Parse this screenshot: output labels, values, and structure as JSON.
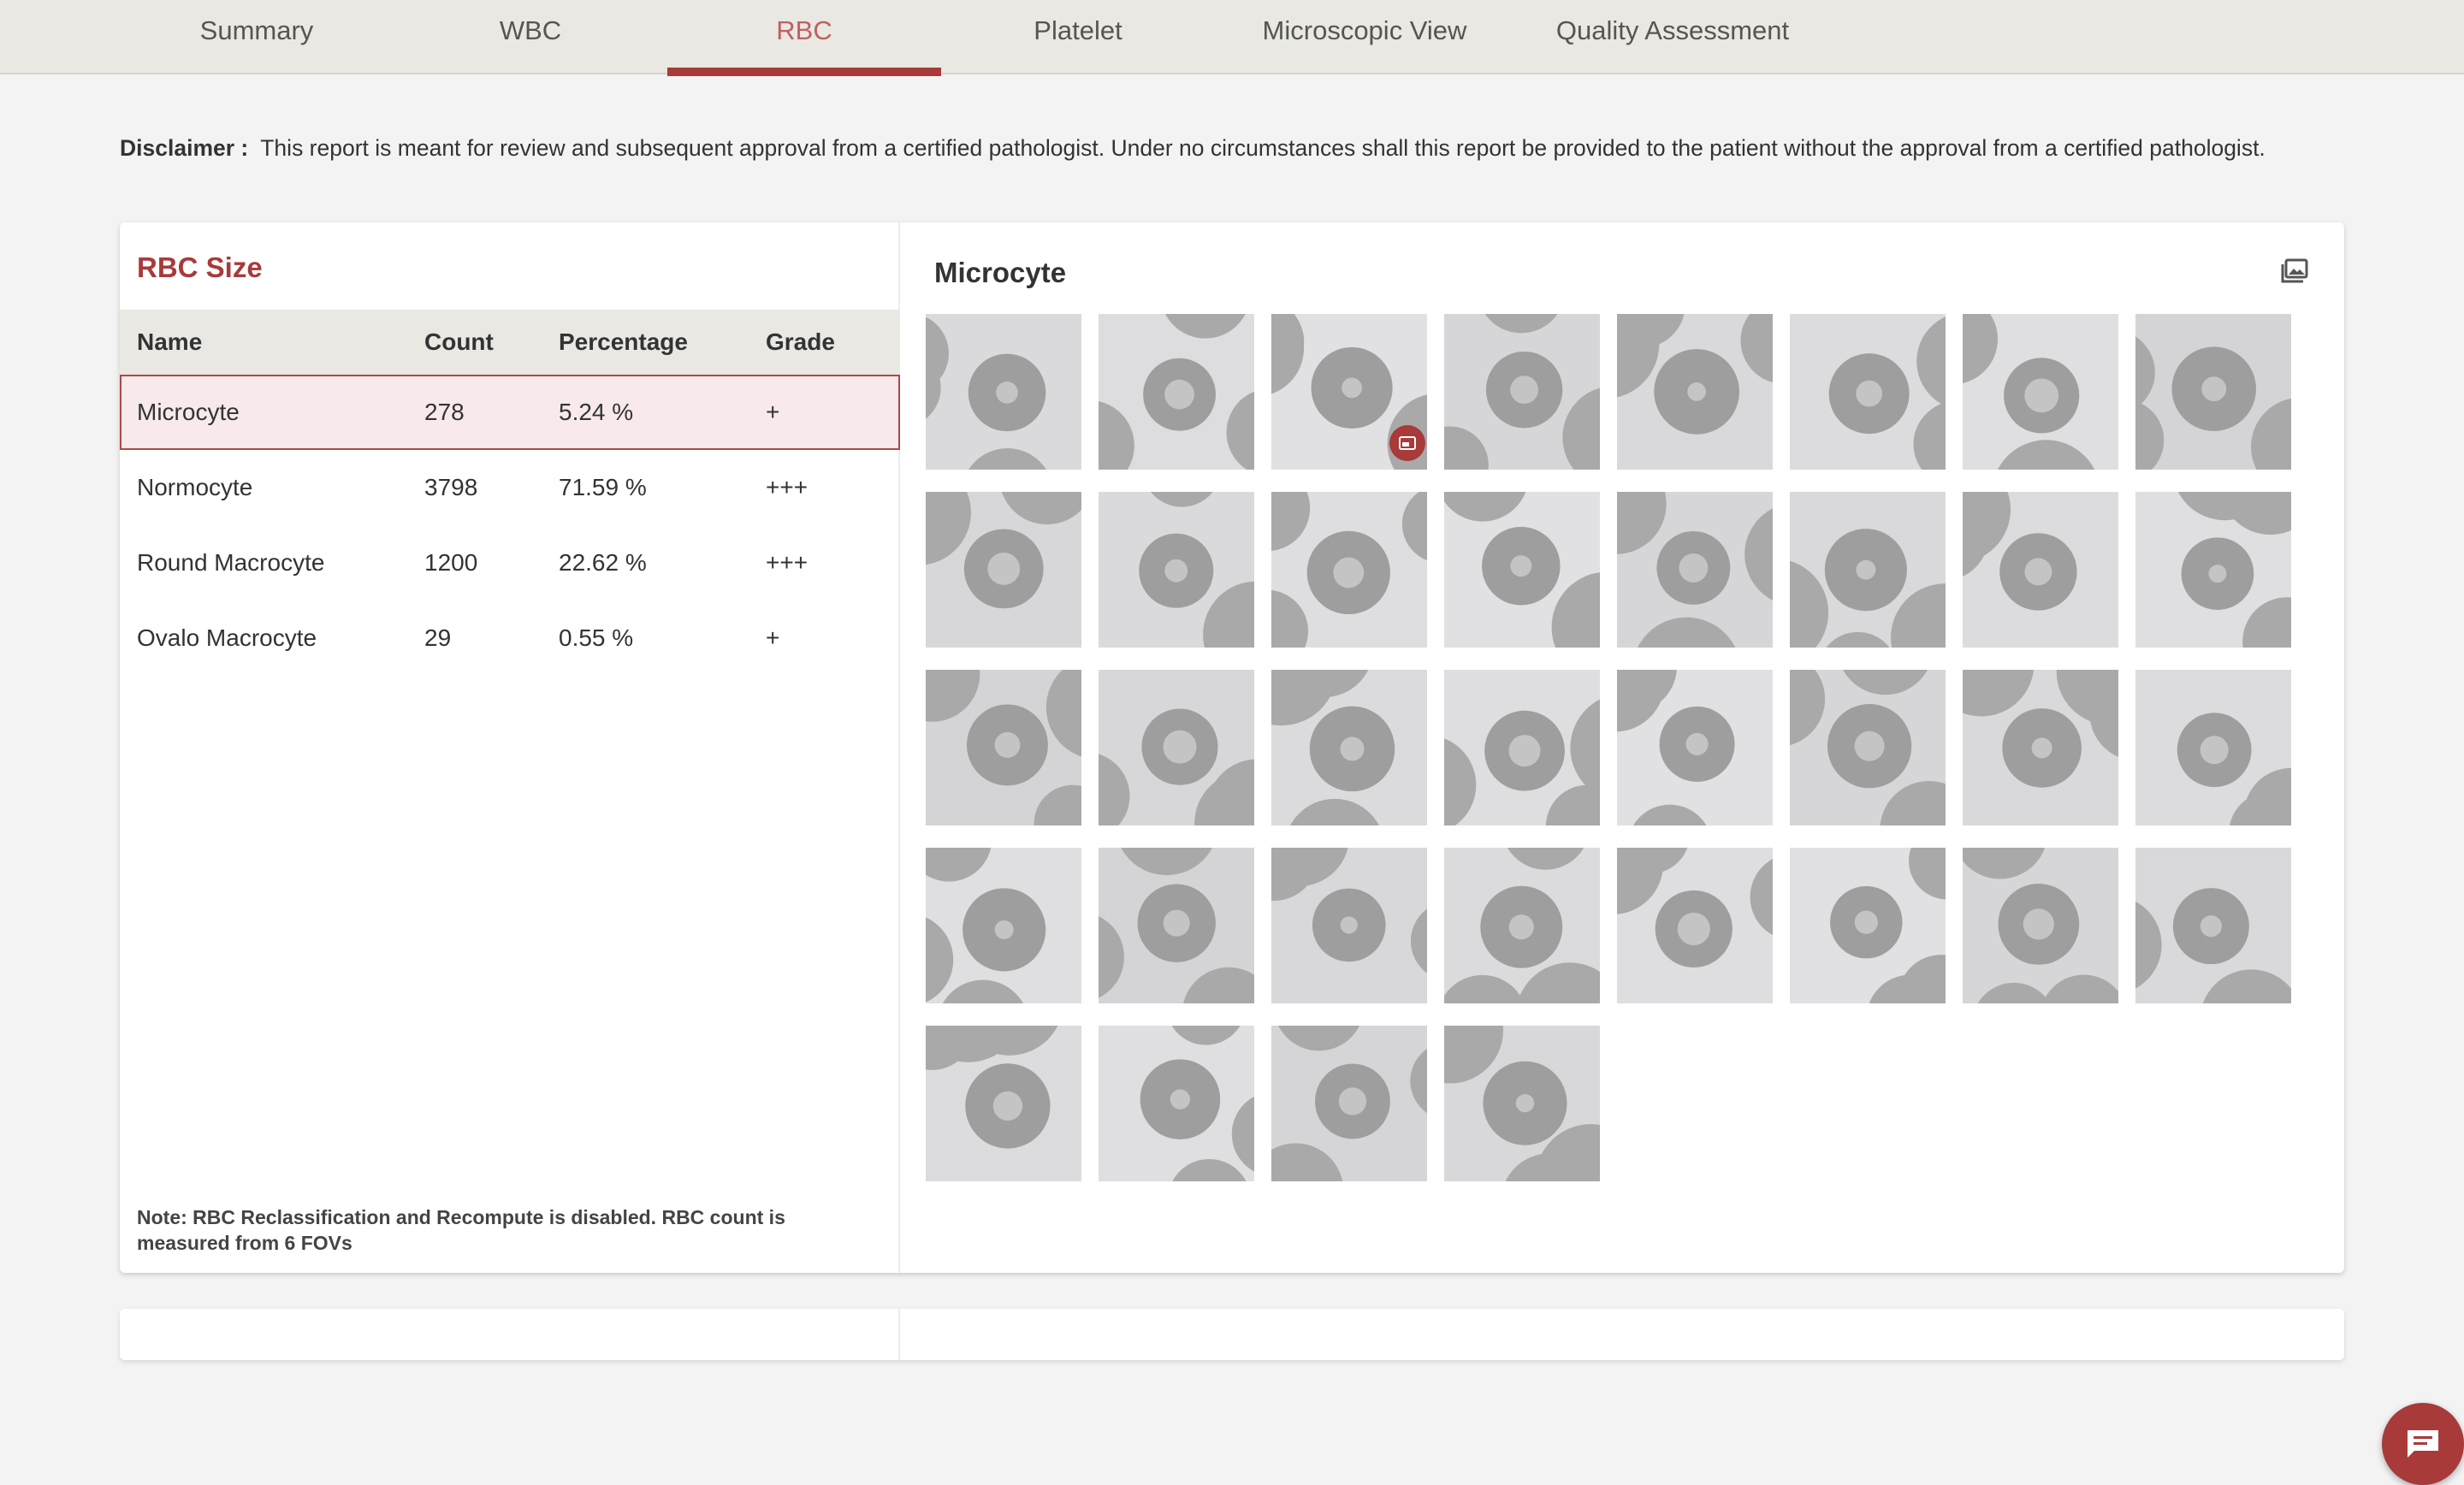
{
  "tabs": [
    {
      "label": "Summary",
      "active": false
    },
    {
      "label": "WBC",
      "active": false
    },
    {
      "label": "RBC",
      "active": true
    },
    {
      "label": "Platelet",
      "active": false
    },
    {
      "label": "Microscopic View",
      "active": false
    },
    {
      "label": "Quality Assessment",
      "active": false
    }
  ],
  "disclaimer": {
    "label": "Disclaimer :",
    "text": "This report is meant for review and subsequent approval from a certified pathologist. Under no circumstances shall this report be provided to the patient without the approval from a certified pathologist."
  },
  "rbc_size": {
    "title": "RBC Size",
    "columns": [
      "Name",
      "Count",
      "Percentage",
      "Grade"
    ],
    "rows": [
      {
        "name": "Microcyte",
        "count": "278",
        "percentage": "5.24 %",
        "grade": "+",
        "selected": true
      },
      {
        "name": "Normocyte",
        "count": "3798",
        "percentage": "71.59 %",
        "grade": "+++",
        "selected": false
      },
      {
        "name": "Round Macrocyte",
        "count": "1200",
        "percentage": "22.62 %",
        "grade": "+++",
        "selected": false
      },
      {
        "name": "Ovalo Macrocyte",
        "count": "29",
        "percentage": "0.55 %",
        "grade": "+",
        "selected": false
      }
    ],
    "note": "Note: RBC Reclassification and Recompute is disabled. RBC count is measured from 6 FOVs"
  },
  "gallery": {
    "title": "Microcyte",
    "icon": "image-gallery-icon",
    "image_count": 36,
    "badge_icon": "image-badge-icon"
  },
  "chat_button": {
    "icon": "chat-icon"
  },
  "colors": {
    "accent": "#a83a3a",
    "tab_active_text": "#c06060",
    "tab_bar_bg": "#e9e8e2",
    "selected_row_bg": "#f8eaea",
    "page_bg": "#f3f3f3"
  }
}
